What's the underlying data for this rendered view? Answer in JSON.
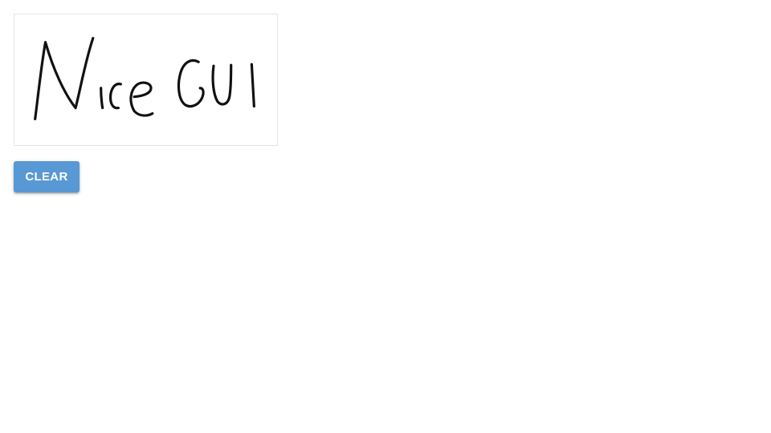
{
  "signature_pad": {
    "drawn_text": "NiceGUI"
  },
  "actions": {
    "clear_label": "CLEAR"
  },
  "colors": {
    "button_bg": "#5898d4",
    "button_text": "#ffffff",
    "ink": "#111111",
    "canvas_border": "#e4e4e4"
  }
}
